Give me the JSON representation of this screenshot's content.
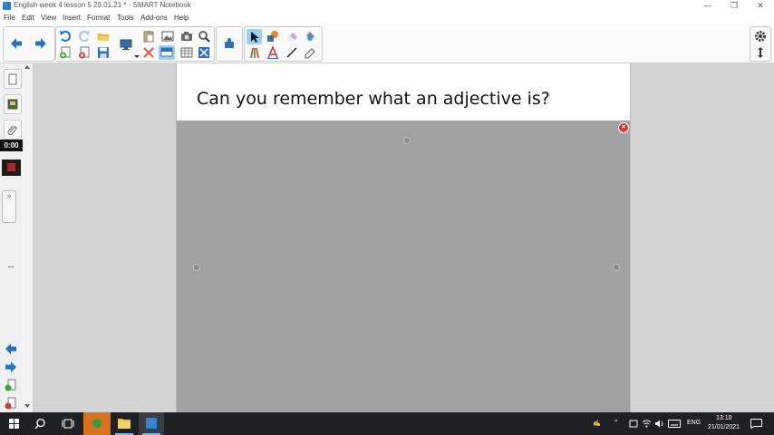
{
  "window": {
    "title": "English week 4 lesson 5  29.01.21 * - SMART Notebook",
    "controls": [
      "—",
      "❐",
      "✕"
    ]
  },
  "menu": {
    "items": [
      "File",
      "Edit",
      "View",
      "Insert",
      "Format",
      "Tools",
      "Add-ons",
      "Help"
    ]
  },
  "page": {
    "heading": "Can you remember what an adjective is?",
    "shade_close": "×"
  },
  "sidebar": {
    "timer": "0:00",
    "collapse_glyph": "»",
    "resize_glyph": "↔"
  },
  "taskbar": {
    "time": "13:10",
    "date": "21/01/2021",
    "language": "ENG"
  },
  "colors": {
    "accent_blue": "#1e73c8",
    "page_background": "#ffffff",
    "screen_shade": "#a3a2a2",
    "taskbar": "#1f2024"
  }
}
